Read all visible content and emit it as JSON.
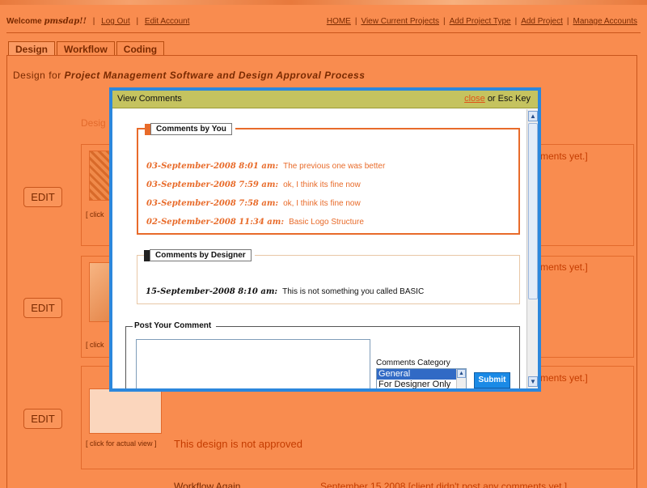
{
  "header": {
    "welcome_prefix": "Welcome",
    "username": "pmsdap!!",
    "logout": "Log Out",
    "edit_account": "Edit Account",
    "nav": [
      "HOME",
      "View Current Projects",
      "Add Project Type",
      "Add Project",
      "Manage Accounts"
    ]
  },
  "tabs": [
    "Design",
    "Workflow",
    "Coding"
  ],
  "page": {
    "design_for_prefix": "Design for",
    "project_name": "Project Management Software and Design Approval Process",
    "desig_fragment": "Desig"
  },
  "background": {
    "edit_label": "EDIT",
    "click_fragment": "[ click",
    "click_full": "[ click for actual view ]",
    "not_approved": "This design is not approved",
    "no_comments_fragment": "ments yet.]",
    "workflow_again": "Workflow Again",
    "workflow_meta": "September 15 2008 [client didn't post any comments yet.]"
  },
  "modal": {
    "title": "View Comments",
    "close_link": "close",
    "close_suffix": "or Esc Key",
    "comments_by_you_label": "Comments by You",
    "comments_by_you": [
      {
        "date": "03-September-2008 8:01 am:",
        "text": "The previous one was better"
      },
      {
        "date": "03-September-2008 7:59 am:",
        "text": "ok, I think its fine now"
      },
      {
        "date": "03-September-2008 7:58 am:",
        "text": "ok, I think its fine now"
      },
      {
        "date": "02-September-2008 11:34 am:",
        "text": "Basic Logo Structure"
      }
    ],
    "comments_by_designer_label": "Comments by Designer",
    "comments_by_designer": [
      {
        "date": "15-September-2008 8:10 am:",
        "text": "This is not something you called BASIC"
      }
    ],
    "post_label": "Post Your Comment",
    "comment_value": "",
    "category_label": "Comments Category",
    "category_options": [
      "General",
      "For Designer Only"
    ],
    "category_selected": "General",
    "submit_label": "Submit"
  },
  "colors": {
    "page_bg": "#f98c4f",
    "modal_border": "#2c87dc",
    "modal_titlebar": "#c5c35f",
    "comment_accent": "#e86b2a",
    "submit_bg": "#1a8ae6"
  }
}
